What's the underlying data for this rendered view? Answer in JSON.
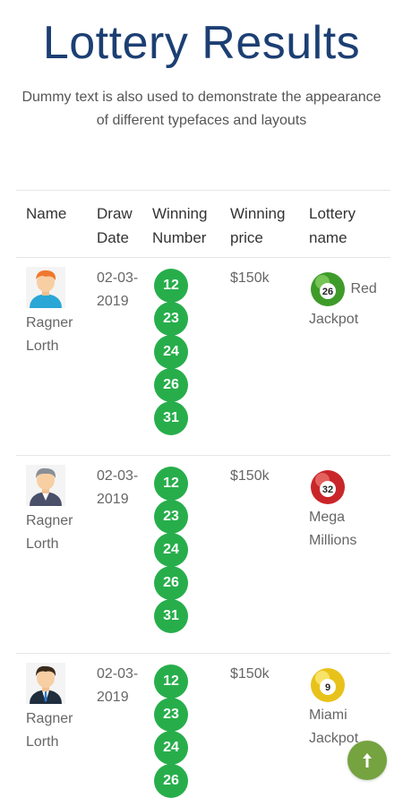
{
  "header": {
    "title": "Lottery Results",
    "subtitle": "Dummy text is also used to demonstrate the appearance of different typefaces and layouts"
  },
  "table": {
    "columns": [
      "Name",
      "Draw Date",
      "Winning Number",
      "Winning price",
      "Lottery name"
    ],
    "rows": [
      {
        "name": "Ragner Lorth",
        "avatar": "man-orange-hair-avatar",
        "draw_date": "02-03-2019",
        "numbers": [
          "12",
          "23",
          "24",
          "26",
          "31"
        ],
        "price": "$150k",
        "lottery_ball_number": "26",
        "lottery_ball_color": "green",
        "lottery_name": "Red Jackpot"
      },
      {
        "name": "Ragner Lorth",
        "avatar": "man-gray-hair-avatar",
        "draw_date": "02-03-2019",
        "numbers": [
          "12",
          "23",
          "24",
          "26",
          "31"
        ],
        "price": "$150k",
        "lottery_ball_number": "32",
        "lottery_ball_color": "red",
        "lottery_name": "Mega Millions"
      },
      {
        "name": "Ragner Lorth",
        "avatar": "man-suit-avatar",
        "draw_date": "02-03-2019",
        "numbers": [
          "12",
          "23",
          "24",
          "26"
        ],
        "price": "$150k",
        "lottery_ball_number": "9",
        "lottery_ball_color": "yellow",
        "lottery_name": "Miami Jackpot"
      }
    ]
  },
  "colors": {
    "title": "#1c3f73",
    "ball": "#27ae4b",
    "scroll_button": "#75a340"
  },
  "icons": {
    "scroll_top": "arrow-up-icon"
  }
}
